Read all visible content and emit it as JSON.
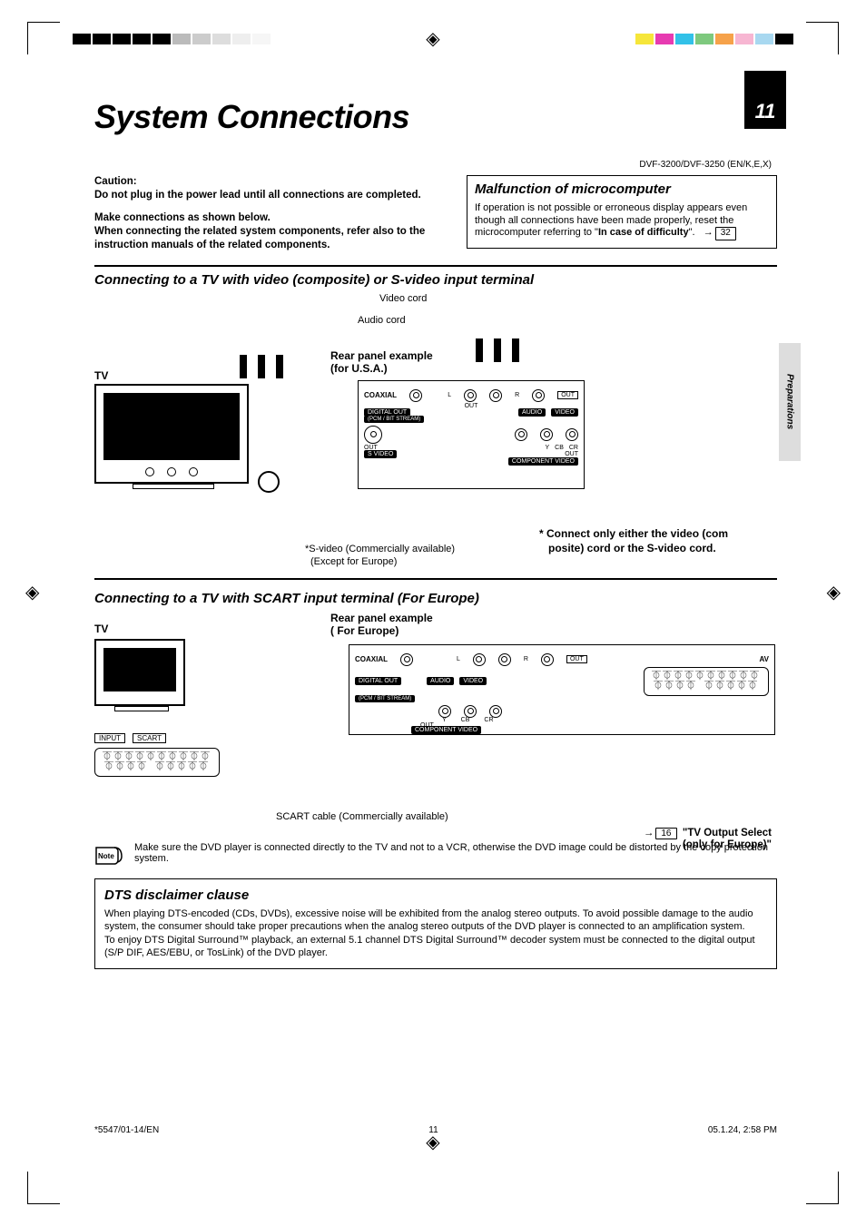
{
  "pageNumber": "11",
  "title": "System Connections",
  "docId": "DVF-3200/DVF-3250 (EN/K,E,X)",
  "caution": {
    "heading": "Caution:",
    "line1": "Do not plug in the power lead until all connections are completed.",
    "line2": "Make connections as shown below.",
    "line3": "When connecting the related system components, refer also to the instruction manuals of the related components."
  },
  "malbox": {
    "heading": "Malfunction of microcomputer",
    "body_a": "If operation is not possible or erroneous display appears even though all connections have been made properly, reset the microcomputer referring to \"",
    "body_bold": "In case of difficulty",
    "body_b": "\".",
    "pageRef": "32"
  },
  "sideTab": "Preparations",
  "section1": {
    "heading": "Connecting to a TV with video (composite) or S-video input terminal",
    "labels": {
      "videoCord": "Video cord",
      "audioCord": "Audio cord",
      "rearPanelLine1": "Rear panel example",
      "rearPanelLine2": "(for U.S.A.)",
      "tv": "TV",
      "svideoLine1": "*S-video (Commercially available)",
      "svideoLine2": "(Except for Europe)",
      "connectNoteLine1": "* Connect only either the video (com",
      "connectNoteLine2": "posite) cord or the S-video cord."
    },
    "panel": {
      "coaxial": "COAXIAL",
      "digitalOut1": "DIGITAL OUT",
      "digitalOut2": "(PCM / BIT STREAM)",
      "out": "OUT",
      "audio": "AUDIO",
      "video": "VIDEO",
      "svideoOut": "S VIDEO",
      "componentOut": "COMPONENT VIDEO",
      "y": "Y",
      "cb": "CB",
      "cr": "CR",
      "l": "L",
      "r": "R"
    }
  },
  "section2": {
    "heading": "Connecting to a TV with SCART input terminal (For Europe)",
    "rearPanelLine1": "Rear panel example",
    "rearPanelLine2": "( For Europe)",
    "tv": "TV",
    "input": "INPUT",
    "scart": "SCART",
    "av": "AV",
    "scartCable": "SCART cable (Commercially available)",
    "tvOutLine1": "\"TV  Output Select",
    "tvOutLine2": "(only for Europe)\"",
    "tvOutRef": "16"
  },
  "note": {
    "label": "Note",
    "text": "Make sure the DVD player is connected directly to the TV and not to a VCR, otherwise the DVD image could be distorted by the copy protection system."
  },
  "dts": {
    "heading": "DTS disclaimer clause",
    "p1": "When playing DTS-encoded (CDs, DVDs), excessive noise will be exhibited from the analog stereo outputs. To avoid possible damage to the audio system, the consumer should take proper precautions when the analog stereo outputs of the DVD player is connected to an amplification system.",
    "p2": "To enjoy DTS Digital Surround™ playback, an external 5.1 channel DTS Digital Surround™ decoder system must be connected to the digital output (S/P DIF, AES/EBU, or TosLink) of the DVD player."
  },
  "footer": {
    "left": "*5547/01-14/EN",
    "center": "11",
    "right": "05.1.24, 2:58 PM"
  }
}
